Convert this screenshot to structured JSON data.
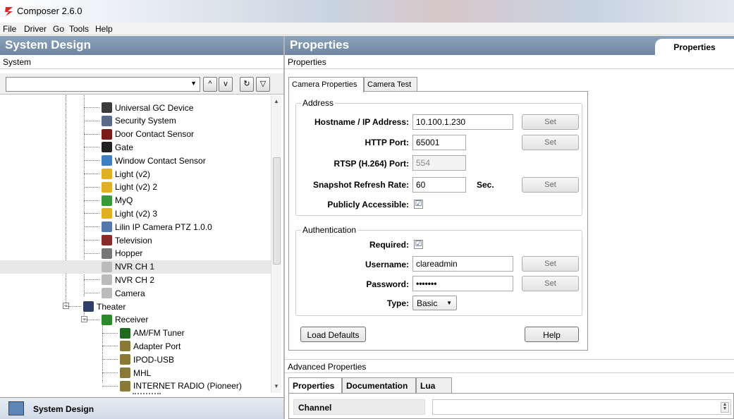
{
  "window": {
    "title": "Composer 2.6.0"
  },
  "menu": [
    "File",
    "Driver",
    "Go",
    "Tools",
    "Help"
  ],
  "left_panel": {
    "header": "System Design",
    "subheader": "System",
    "footer_label": "System Design",
    "tree": [
      {
        "label": "Universal GC Device",
        "icon_color": "#3b3b3b",
        "indent": 2
      },
      {
        "label": "Security System",
        "icon_color": "#5a6b8a",
        "indent": 2
      },
      {
        "label": "Door Contact Sensor",
        "icon_color": "#7a1a1a",
        "indent": 2
      },
      {
        "label": "Gate",
        "icon_color": "#222222",
        "indent": 2
      },
      {
        "label": "Window Contact Sensor",
        "icon_color": "#3f7fbf",
        "indent": 2
      },
      {
        "label": "Light (v2)",
        "icon_color": "#e0b020",
        "indent": 2
      },
      {
        "label": "Light (v2) 2",
        "icon_color": "#e0b020",
        "indent": 2
      },
      {
        "label": "MyQ",
        "icon_color": "#3a9a3a",
        "indent": 2
      },
      {
        "label": "Light (v2) 3",
        "icon_color": "#e0b020",
        "indent": 2
      },
      {
        "label": "Lilin IP Camera PTZ 1.0.0",
        "icon_color": "#5577aa",
        "indent": 2
      },
      {
        "label": "Television",
        "icon_color": "#8a2a2a",
        "indent": 2
      },
      {
        "label": "Hopper",
        "icon_color": "#777777",
        "indent": 2
      },
      {
        "label": "NVR CH 1",
        "icon_color": "#bbbbbb",
        "indent": 2
      },
      {
        "label": "NVR CH 2",
        "icon_color": "#bbbbbb",
        "indent": 2
      },
      {
        "label": "Camera",
        "icon_color": "#bbbbbb",
        "indent": 2
      },
      {
        "label": "Theater",
        "icon_color": "#2f3f6a",
        "indent": 1
      },
      {
        "label": "Receiver",
        "icon_color": "#2a8a2a",
        "indent": 2
      },
      {
        "label": "AM/FM Tuner",
        "icon_color": "#1f6a1f",
        "indent": 3
      },
      {
        "label": "Adapter Port",
        "icon_color": "#8a7a3a",
        "indent": 3
      },
      {
        "label": "IPOD-USB",
        "icon_color": "#8a7a3a",
        "indent": 3
      },
      {
        "label": "MHL",
        "icon_color": "#8a7a3a",
        "indent": 3
      },
      {
        "label": "INTERNET RADIO (Pioneer)",
        "icon_color": "#8a7a3a",
        "indent": 3
      }
    ]
  },
  "right_panel": {
    "header": "Properties",
    "header_tab": "Properties",
    "subheader": "Properties",
    "tabs": [
      "Camera Properties",
      "Camera Test"
    ],
    "address_group": {
      "title": "Address",
      "hostname_label": "Hostname / IP Address:",
      "hostname_value": "10.100.1.230",
      "http_label": "HTTP Port:",
      "http_value": "65001",
      "rtsp_label": "RTSP (H.264) Port:",
      "rtsp_value": "554",
      "snapshot_label": "Snapshot Refresh Rate:",
      "snapshot_value": "60",
      "snapshot_unit": "Sec.",
      "public_label": "Publicly Accessible:",
      "public_checked": "☑"
    },
    "auth_group": {
      "title": "Authentication",
      "required_label": "Required:",
      "required_checked": "☑",
      "username_label": "Username:",
      "username_value": "clareadmin",
      "password_label": "Password:",
      "password_value": "•••••••",
      "type_label": "Type:",
      "type_value": "Basic"
    },
    "set_label": "Set",
    "load_defaults": "Load Defaults",
    "help": "Help"
  },
  "advanced": {
    "subheader": "Advanced Properties",
    "tabs": [
      "Properties",
      "Documentation",
      "Lua"
    ],
    "channel_label": "Channel",
    "channel_value": ""
  }
}
